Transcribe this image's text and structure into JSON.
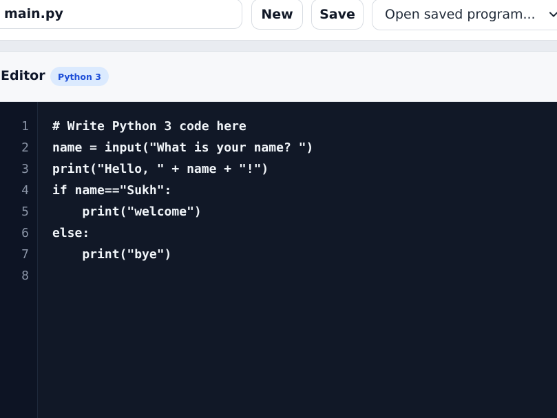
{
  "toolbar": {
    "filename": "main.py",
    "new_label": "New",
    "save_label": "Save",
    "open_saved_label": "Open saved program..."
  },
  "editor": {
    "title": "Editor",
    "language_badge": "Python 3",
    "line_numbers": [
      "1",
      "2",
      "3",
      "4",
      "5",
      "6",
      "7",
      "8"
    ],
    "code_lines": [
      "# Write Python 3 code here",
      "name = input(\"What is your name? \")",
      "print(\"Hello, \" + name + \"!\")",
      "if name==\"Sukh\":",
      "    print(\"welcome\")",
      "else:",
      "    print(\"bye\")",
      ""
    ]
  },
  "colors": {
    "editor_background": "#111827",
    "gutter_background": "#0d1424",
    "badge_background": "#dbeafe",
    "badge_text": "#1d4ed8"
  }
}
